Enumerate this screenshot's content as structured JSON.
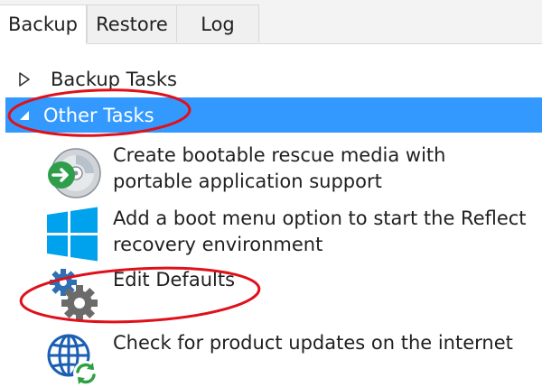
{
  "tabs": [
    {
      "label": "Backup",
      "active": true
    },
    {
      "label": "Restore",
      "active": false
    },
    {
      "label": "Log",
      "active": false
    }
  ],
  "tree": {
    "backup_tasks": {
      "label": "Backup Tasks",
      "expanded": false
    },
    "other_tasks": {
      "label": "Other Tasks",
      "expanded": true,
      "selected": true
    }
  },
  "tasks": [
    {
      "label": "Create bootable rescue media with portable application support",
      "icon": "rescue-media-icon"
    },
    {
      "label": "Add a boot menu option to start the Reflect recovery environment",
      "icon": "windows-logo-icon"
    },
    {
      "label": "Edit Defaults",
      "icon": "gears-icon"
    },
    {
      "label": "Check for product updates on the internet",
      "icon": "globe-update-icon"
    }
  ],
  "colors": {
    "selection": "#3399ff",
    "annotation": "#e0101a",
    "windows_blue": "#00a2ed",
    "gear_gray": "#6b6b6b",
    "gear_blue": "#2f6fb5",
    "globe_blue": "#1a5fb4",
    "update_green": "#2ea043"
  }
}
